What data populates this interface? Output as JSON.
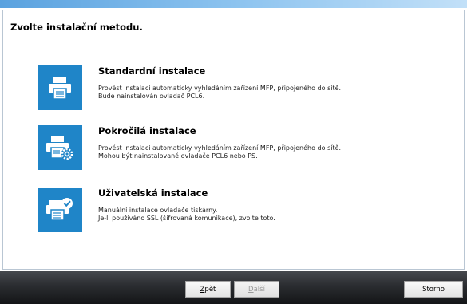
{
  "header": {
    "title": "Zvolte instalační metodu."
  },
  "options": [
    {
      "icon": "printer-icon",
      "title": "Standardní instalace",
      "desc_line1": "Provést instalaci automaticky vyhledáním zařízení MFP, připojeného do sítě.",
      "desc_line2": "Bude nainstalován ovladač PCL6."
    },
    {
      "icon": "printer-gear-icon",
      "title": "Pokročilá instalace",
      "desc_line1": "Provést instalaci automaticky vyhledáním zařízení MFP, připojeného do sítě.",
      "desc_line2": "Mohou být nainstalované ovladače PCL6 nebo PS."
    },
    {
      "icon": "printer-check-icon",
      "title": "Uživatelská instalace",
      "desc_line1": "Manuální instalace ovladače tiskárny.",
      "desc_line2": "Je-li používáno SSL (šifrovaná komunikace), zvolte toto."
    }
  ],
  "footer": {
    "back_key": "Z",
    "back_rest": "pět",
    "next_key": "D",
    "next_rest": "alší",
    "cancel_label": "Storno"
  },
  "colors": {
    "tile": "#1f85c8",
    "footer": "#2a2c30"
  }
}
